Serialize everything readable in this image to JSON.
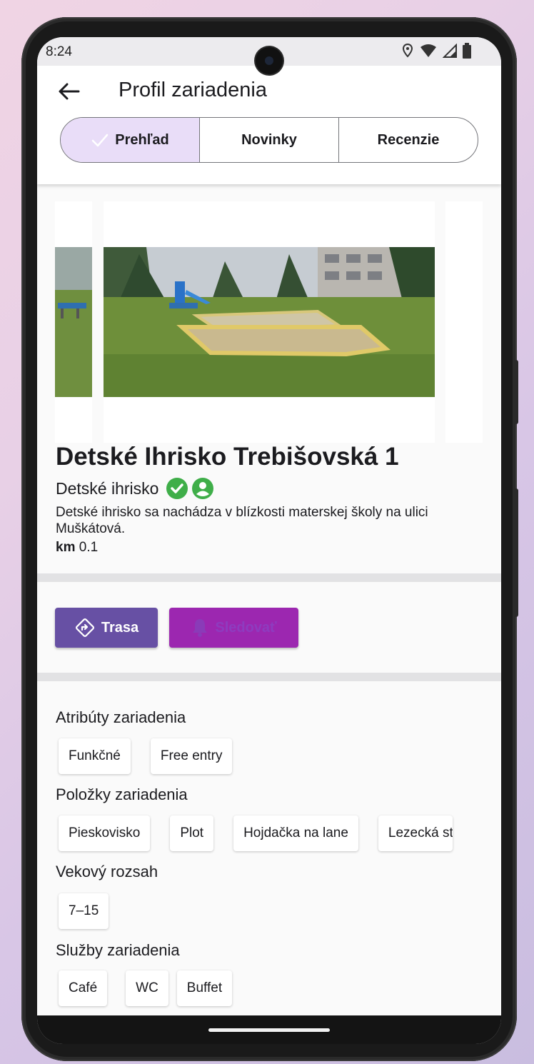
{
  "status": {
    "time": "8:24"
  },
  "appbar": {
    "title": "Profil zariadenia"
  },
  "tabs": [
    {
      "label": "Prehľad",
      "selected": true
    },
    {
      "label": "Novinky",
      "selected": false
    },
    {
      "label": "Recenzie",
      "selected": false
    }
  ],
  "place": {
    "title": "Detské Ihrisko Trebišovská 1",
    "category": "Detské ihrisko",
    "description": "Detské ihrisko sa nachádza v blízkosti materskej školy na ulici Muškátová.",
    "distance_unit": "km",
    "distance_value": "0.1"
  },
  "actions": {
    "route_label": "Trasa",
    "follow_label": "Sledovať"
  },
  "sections": {
    "attributes": {
      "title": "Atribúty zariadenia",
      "chips": [
        "Funkčné",
        "Free entry"
      ]
    },
    "items": {
      "title": "Položky zariadenia",
      "chips": [
        "Pieskovisko",
        "Plot",
        "Hojdačka na lane",
        "Lezecká stena"
      ]
    },
    "age": {
      "title": "Vekový rozsah",
      "chips": [
        "7–15"
      ]
    },
    "services": {
      "title": "Služby zariadenia",
      "chips": [
        "Café",
        "WC",
        "Buffet"
      ]
    }
  },
  "colors": {
    "primary": "#6750a4",
    "follow": "#9c27b0",
    "verified": "#3fae49",
    "segment_active": "#e9ddf8"
  },
  "icons": [
    "back-arrow-icon",
    "check-icon",
    "verified-check-icon",
    "account-circle-icon",
    "directions-icon",
    "bell-icon",
    "location-icon",
    "wifi-icon",
    "signal-icon",
    "battery-icon"
  ]
}
